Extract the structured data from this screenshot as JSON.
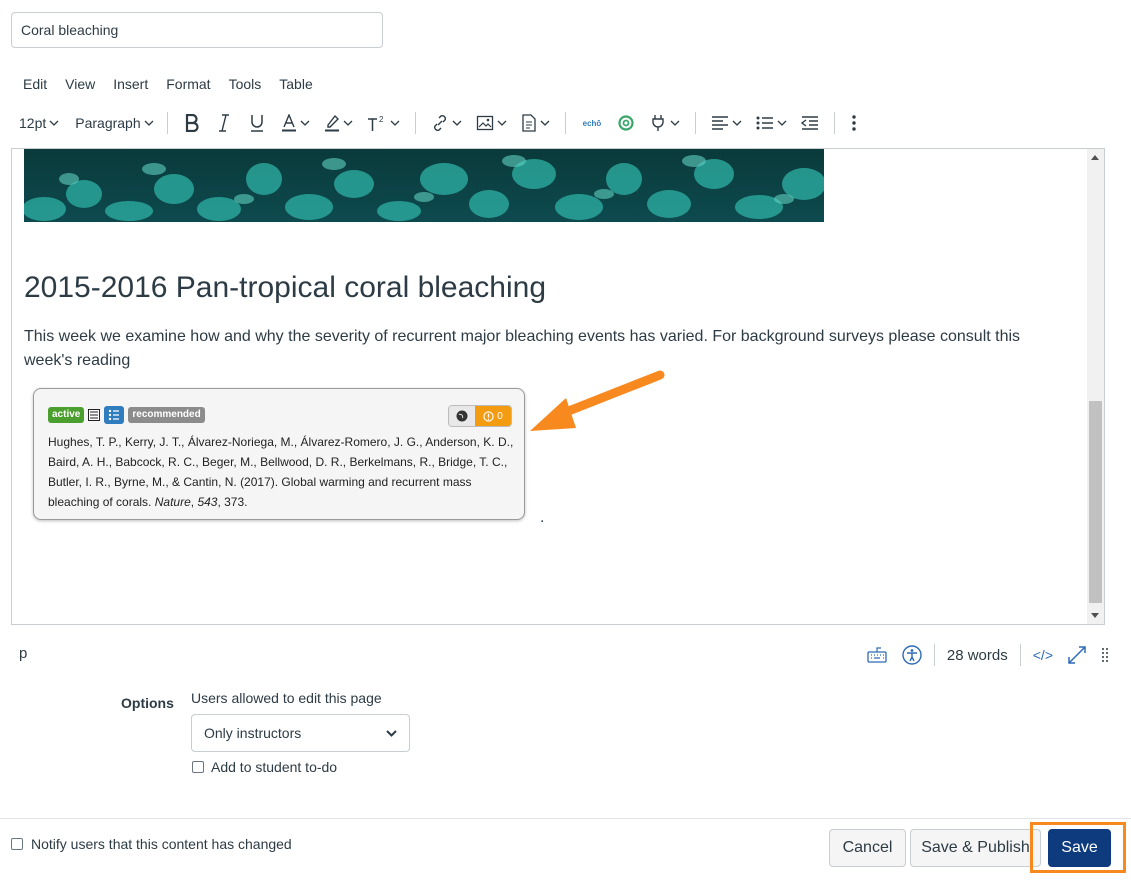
{
  "title_input": {
    "value": "Coral bleaching"
  },
  "menubar": [
    "Edit",
    "View",
    "Insert",
    "Format",
    "Tools",
    "Table"
  ],
  "toolbar": {
    "font_size": "12pt",
    "block_format": "Paragraph",
    "echo_label": "echō"
  },
  "content": {
    "heading": "2015-2016 Pan-tropical coral bleaching",
    "paragraph": "This week we examine how and why the severity of recurrent major bleaching events has varied. For background surveys please consult this week's reading",
    "trailing_dot": "."
  },
  "citation_card": {
    "badge_active": "active",
    "badge_recommended": "recommended",
    "count": "0",
    "citation_main": "Hughes, T. P., Kerry, J. T., Álvarez-Noriega, M., Álvarez-Romero, J. G., Anderson, K. D., Baird, A. H., Babcock, R. C., Beger, M., Bellwood, D. R., Berkelmans, R., Bridge, T. C., Butler, I. R., Byrne, M., & Cantin, N. (2017). Global warming and recurrent mass bleaching of corals. ",
    "journal": "Nature",
    "sep1": ", ",
    "volume": "543",
    "pages": ", 373."
  },
  "statusbar": {
    "path": "p",
    "word_count": "28 words",
    "html_toggle": "</>"
  },
  "options": {
    "label": "Options",
    "edit_label": "Users allowed to edit this page",
    "edit_selected": "Only instructors",
    "todo_label": "Add to student to-do"
  },
  "footer": {
    "notify_label": "Notify users that this content has changed",
    "cancel": "Cancel",
    "save_publish": "Save & Publish",
    "save": "Save"
  },
  "colors": {
    "accent_arrow": "#f7891e",
    "primary_button": "#0e3b7d",
    "badge_active": "#4a9f2e",
    "badge_recommended": "#8c8c8c",
    "badge_list": "#2f7cbf",
    "count_badge": "#f39c12",
    "highlight_box": "#f7891e"
  }
}
